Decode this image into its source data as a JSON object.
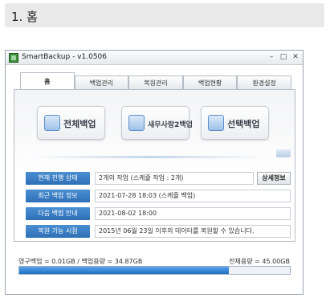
{
  "page": {
    "heading": "1. 홈"
  },
  "window": {
    "title": "SmartBackup - v1.0506"
  },
  "tabs": [
    {
      "label": "홈"
    },
    {
      "label": "백업관리"
    },
    {
      "label": "복원관리"
    },
    {
      "label": "백업현황"
    },
    {
      "label": "환경설정"
    }
  ],
  "actions": {
    "full_backup": "전체백업",
    "new_backup": "새무사랑2백업",
    "select_backup": "선택백업"
  },
  "info": {
    "status_label": "현재 진행 상태",
    "status_value": "2개의 작업 (스케쥴 작업 : 2개)",
    "detail_button": "상세정보",
    "recent_label": "최근 백업 정보",
    "recent_value": "2021-07-28 18:03 (스케쥴 백업)",
    "next_label": "다음 백업 안내",
    "next_value": "2021-08-02 18:00",
    "restore_label": "복원 가능 시점",
    "restore_value": "2015년 06월 23일 이후의 데이터를 복원할 수 있습니다."
  },
  "usage": {
    "left_text": "영구백업 = 0.01GB / 백업용량 = 34.87GB",
    "right_text": "전체용량 = 45.00GB",
    "fill_percent": 77.5
  }
}
